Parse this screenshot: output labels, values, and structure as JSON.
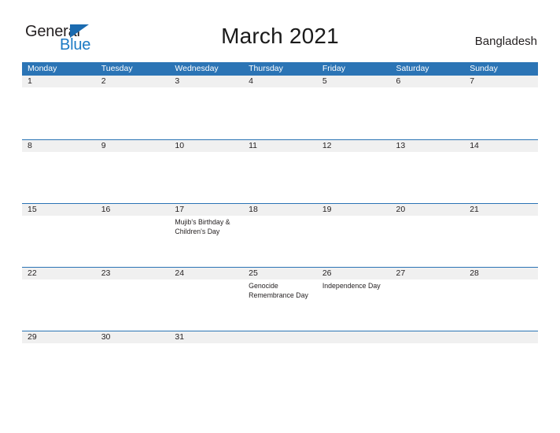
{
  "brand": {
    "name_part1": "General",
    "name_part2": "Blue",
    "triangle_icon": "triangle-icon",
    "colors": {
      "dark": "#231f20",
      "blue": "#1b7ac4",
      "triangle": "#1b6bb0"
    }
  },
  "header": {
    "title": "March 2021",
    "country": "Bangladesh"
  },
  "theme": {
    "header_bar": "#2b74b5",
    "row_band": "#f0f0f0",
    "rule": "#2b74b5",
    "text": "#231f20",
    "header_text": "#ffffff",
    "page_bg": "#ffffff"
  },
  "calendar": {
    "weekdays": [
      "Monday",
      "Tuesday",
      "Wednesday",
      "Thursday",
      "Friday",
      "Saturday",
      "Sunday"
    ],
    "weeks": [
      [
        {
          "day": "1",
          "events": []
        },
        {
          "day": "2",
          "events": []
        },
        {
          "day": "3",
          "events": []
        },
        {
          "day": "4",
          "events": []
        },
        {
          "day": "5",
          "events": []
        },
        {
          "day": "6",
          "events": []
        },
        {
          "day": "7",
          "events": []
        }
      ],
      [
        {
          "day": "8",
          "events": []
        },
        {
          "day": "9",
          "events": []
        },
        {
          "day": "10",
          "events": []
        },
        {
          "day": "11",
          "events": []
        },
        {
          "day": "12",
          "events": []
        },
        {
          "day": "13",
          "events": []
        },
        {
          "day": "14",
          "events": []
        }
      ],
      [
        {
          "day": "15",
          "events": []
        },
        {
          "day": "16",
          "events": []
        },
        {
          "day": "17",
          "events": [
            "Mujib's Birthday &",
            "Children's Day"
          ]
        },
        {
          "day": "18",
          "events": []
        },
        {
          "day": "19",
          "events": []
        },
        {
          "day": "20",
          "events": []
        },
        {
          "day": "21",
          "events": []
        }
      ],
      [
        {
          "day": "22",
          "events": []
        },
        {
          "day": "23",
          "events": []
        },
        {
          "day": "24",
          "events": []
        },
        {
          "day": "25",
          "events": [
            "Genocide",
            "Remembrance Day"
          ]
        },
        {
          "day": "26",
          "events": [
            "Independence Day"
          ]
        },
        {
          "day": "27",
          "events": []
        },
        {
          "day": "28",
          "events": []
        }
      ],
      [
        {
          "day": "29",
          "events": []
        },
        {
          "day": "30",
          "events": []
        },
        {
          "day": "31",
          "events": []
        },
        {
          "day": "",
          "events": []
        },
        {
          "day": "",
          "events": []
        },
        {
          "day": "",
          "events": []
        },
        {
          "day": "",
          "events": []
        }
      ]
    ]
  }
}
